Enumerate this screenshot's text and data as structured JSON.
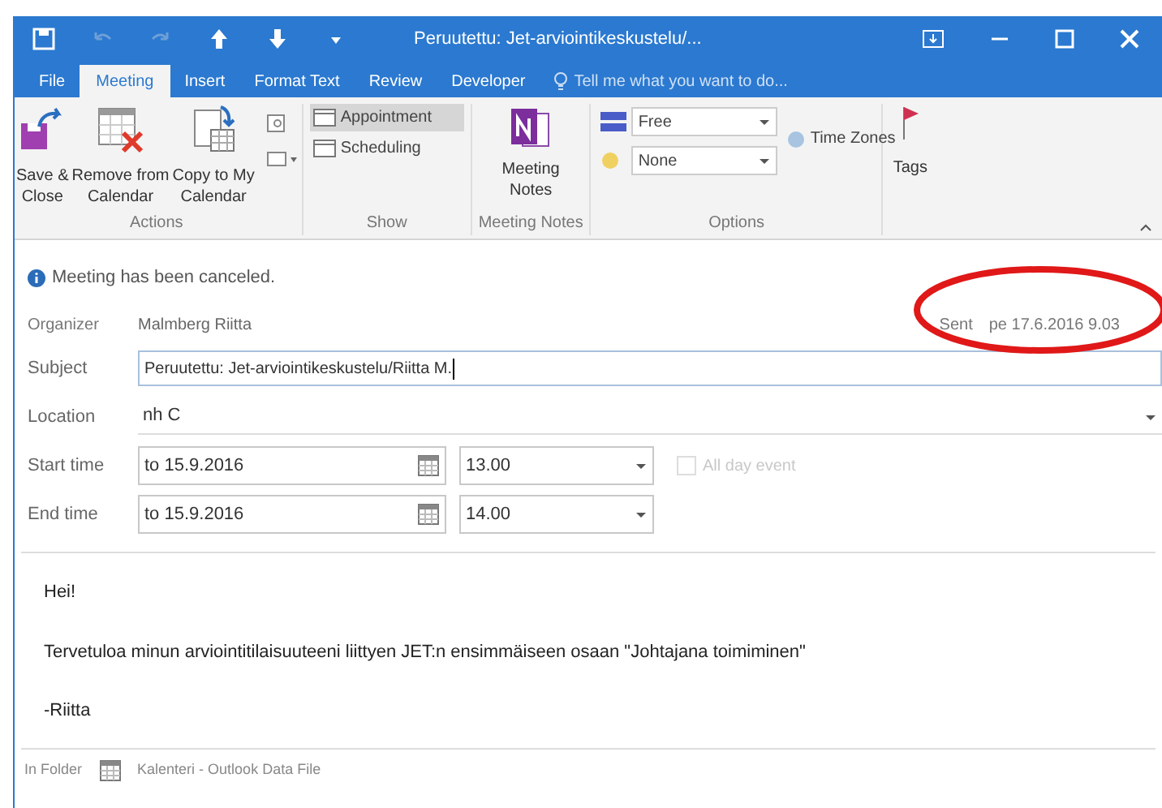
{
  "window": {
    "title": "Peruutettu: Jet-arviointikeskustelu/...",
    "quick_access": [
      {
        "kind": "save",
        "disabled": false
      },
      {
        "kind": "undo",
        "disabled": true
      },
      {
        "kind": "redo",
        "disabled": true
      },
      {
        "kind": "up",
        "disabled": false
      },
      {
        "kind": "down",
        "disabled": false
      },
      {
        "kind": "caret",
        "disabled": false
      }
    ]
  },
  "tabs": [
    {
      "label": "File",
      "selected": false
    },
    {
      "label": "Meeting",
      "selected": true
    },
    {
      "label": "Insert",
      "selected": false
    },
    {
      "label": "Format Text",
      "selected": false
    },
    {
      "label": "Review",
      "selected": false
    },
    {
      "label": "Developer",
      "selected": false
    }
  ],
  "tell_me": {
    "placeholder": "Tell me what you want to do..."
  },
  "ribbon": {
    "actions": {
      "label": "Actions",
      "buttons": [
        {
          "kind": "save",
          "lines": [
            "Save &",
            "Close"
          ]
        },
        {
          "kind": "remove",
          "lines": [
            "Remove from",
            "Calendar"
          ]
        },
        {
          "kind": "copy",
          "lines": [
            "Copy to My",
            "Calendar"
          ]
        }
      ]
    },
    "show": {
      "label": "Show",
      "items": [
        {
          "label": "Appointment",
          "selected": true
        },
        {
          "label": "Scheduling",
          "selected": false
        }
      ]
    },
    "meeting_notes": {
      "label": "Meeting Notes",
      "button": [
        "Meeting",
        "Notes"
      ]
    },
    "options": {
      "label": "Options",
      "show_as": "Free",
      "reminder": "None",
      "time_zones": "Time Zones"
    },
    "tags": {
      "label": "Tags"
    }
  },
  "info": "Meeting has been canceled.",
  "organizer": {
    "label": "Organizer",
    "value": "Malmberg Riitta"
  },
  "sent": {
    "label": "Sent",
    "value": "pe 17.6.2016 9.03"
  },
  "subject": {
    "label": "Subject",
    "value": "Peruutettu: Jet-arviointikeskustelu/Riitta M."
  },
  "location": {
    "label": "Location",
    "value": "nh C"
  },
  "start": {
    "label": "Start time",
    "date": "to 15.9.2016",
    "time": "13.00"
  },
  "end": {
    "label": "End time",
    "date": "to 15.9.2016",
    "time": "14.00"
  },
  "all_day": {
    "label": "All day event",
    "checked": false,
    "disabled": true
  },
  "body": [
    "Hei!",
    "Tervetuloa minun arviointitilaisuuteeni liittyen JET:n ensimmäiseen osaan \"Johtajana toimiminen\"",
    "-Riitta"
  ],
  "folder": {
    "label": "In Folder",
    "value": "Kalenteri - Outlook Data File"
  },
  "annotation": {
    "kind": "ellipse"
  }
}
